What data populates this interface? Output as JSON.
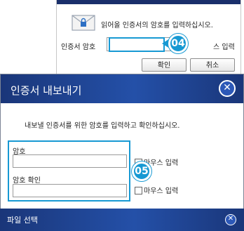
{
  "back_dialog": {
    "prompt": "읽어올 인증서의 암호를 입력하십시오.",
    "password_label": "인증서 암호",
    "mouse_input_label": "스 입력",
    "ok_label": "확인",
    "cancel_label": "취소"
  },
  "callouts": {
    "first": "04",
    "second": "05"
  },
  "main_dialog": {
    "title": "인증서 내보내기",
    "instruction": "내보낼 인증서를 위한 암호를 입력하고 확인하십시오.",
    "password_label": "암호",
    "password_value": "",
    "confirm_label": "암호 확인",
    "confirm_value": "",
    "mouse_input_label_1": "마우스 입력",
    "mouse_input_label_2": "마우스 입력"
  },
  "bottom_dialog": {
    "title": "파일 선택"
  },
  "icons": {
    "close": "close-icon",
    "envelope": "envelope-lock-icon"
  },
  "colors": {
    "titlebar": "#1a3679",
    "callout": "#1799d3"
  }
}
